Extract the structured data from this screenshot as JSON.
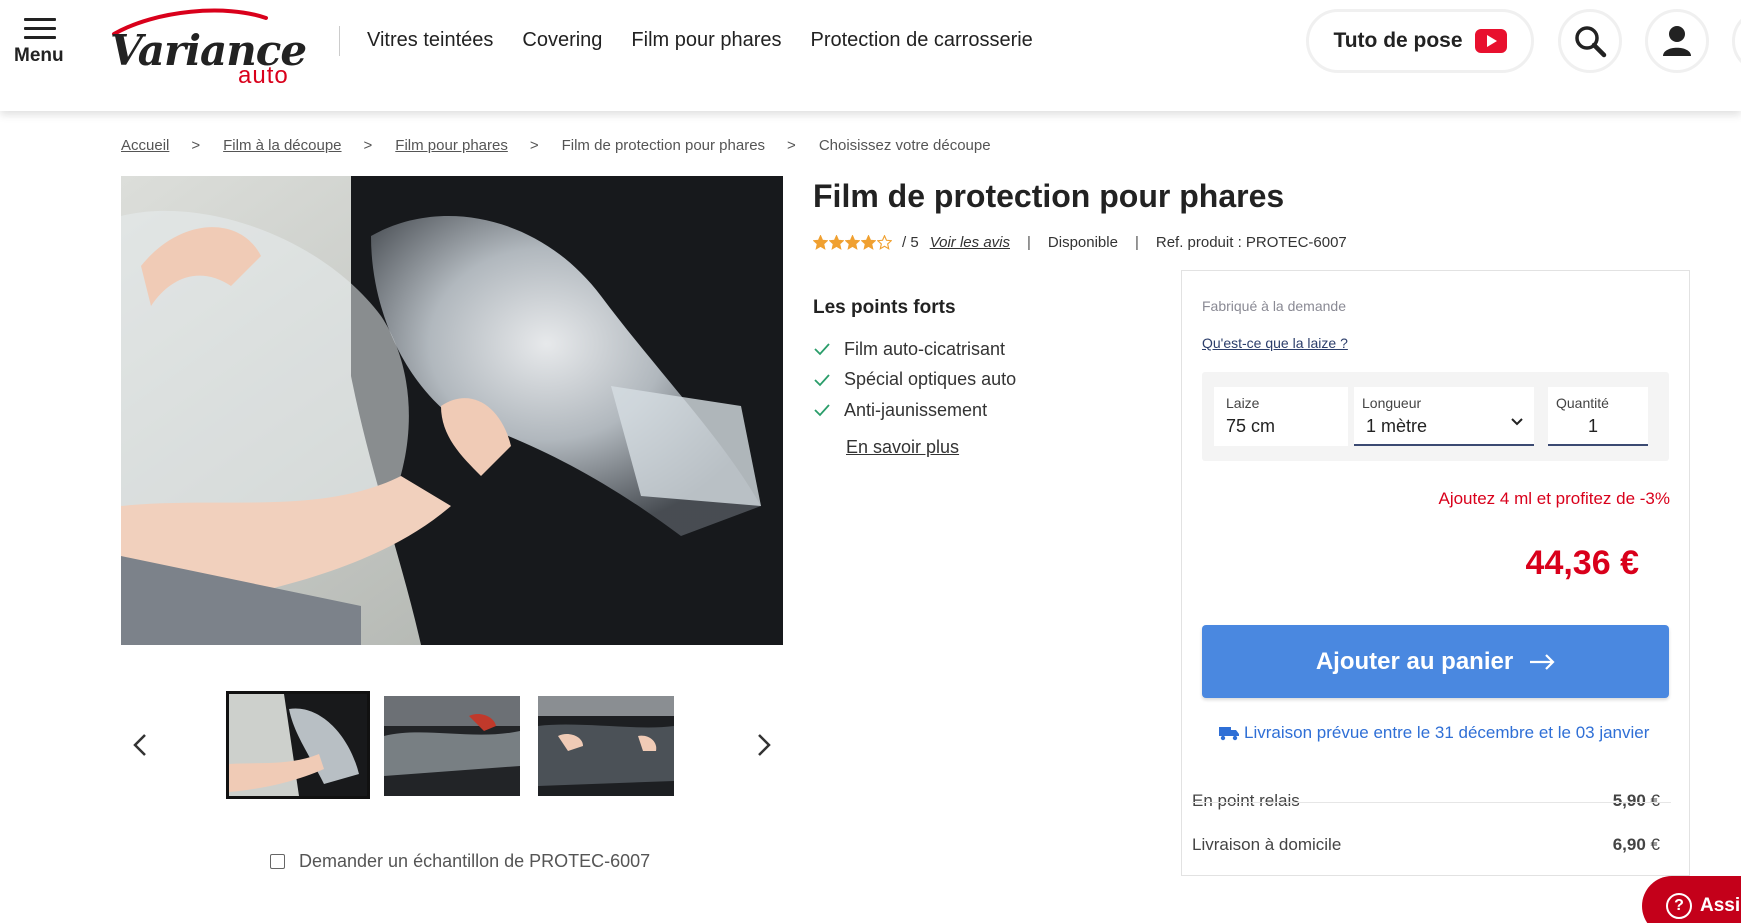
{
  "header": {
    "menu_label": "Menu",
    "logo_word": "Variance",
    "logo_sub": "auto",
    "nav": [
      "Vitres teintées",
      "Covering",
      "Film pour phares",
      "Protection de carrosserie"
    ],
    "tuto_label": "Tuto de pose"
  },
  "breadcrumb": [
    {
      "label": "Accueil",
      "link": true
    },
    {
      "label": "Film à la découpe",
      "link": true
    },
    {
      "label": "Film pour phares",
      "link": true
    },
    {
      "label": "Film de protection pour phares",
      "link": false
    },
    {
      "label": "Choisissez votre découpe",
      "link": false
    }
  ],
  "breadcrumb_separator": ">",
  "product": {
    "title": "Film de protection pour phares",
    "rating": 4,
    "rating_max": "/ 5",
    "reviews_link": "Voir les avis",
    "availability": "Disponible",
    "reference": "Ref. produit : PROTEC-6007",
    "strengths_title": "Les points forts",
    "strengths": [
      "Film auto-cicatrisant",
      "Spécial optiques auto",
      "Anti-jaunissement"
    ],
    "learn_more": "En savoir plus",
    "sample_label": "Demander un échantillon de PROTEC-6007"
  },
  "gallery": {
    "active_index": 0,
    "thumbnails": [
      "headlight-film-application",
      "headlight-film-cutting",
      "headlight-film-laying"
    ]
  },
  "buybox": {
    "made_to_order": "Fabriqué à la demande",
    "laize_link": "Qu'est-ce que la laize ?",
    "laize_label": "Laize",
    "laize_value": "75 cm",
    "length_label": "Longueur",
    "length_value": "1 mètre",
    "qty_label": "Quantité",
    "qty_value": "1",
    "promo": "Ajoutez 4 ml et profitez de -3%",
    "price": "44,36 €",
    "cart_label": "Ajouter au panier",
    "delivery": "Livraison prévue entre le 31 décembre et le 03 janvier",
    "shipping": [
      {
        "label": "En point relais",
        "price": "5,90",
        "currency": "€"
      },
      {
        "label": "Livraison à domicile",
        "price": "6,90",
        "currency": "€"
      }
    ]
  },
  "assist_label": "Assi",
  "colors": {
    "brand_red": "#d9001b",
    "cart_blue": "#4a88e0",
    "delivery_blue": "#2f6fd6",
    "check_green": "#2a9d6a",
    "star_orange": "#f0a030"
  }
}
